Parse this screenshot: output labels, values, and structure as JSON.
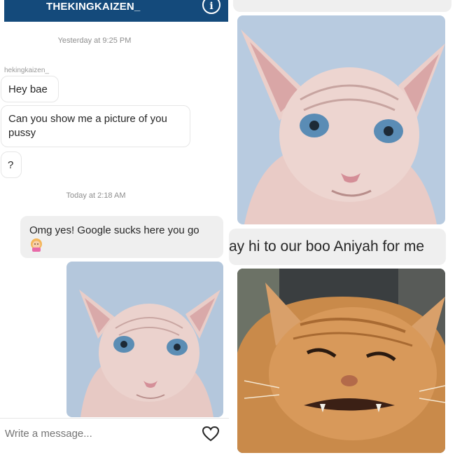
{
  "header": {
    "title": "THEKINGKAIZEN_"
  },
  "thread": {
    "timestamp_1": "Yesterday at 9:25 PM",
    "sender": "hekingkaizen_",
    "msg_1": "Hey bae",
    "msg_2": "Can you show me a picture of you pussy",
    "msg_3": "?",
    "timestamp_2": "Today at 2:18 AM",
    "msg_4": "Omg yes! Google sucks here you go"
  },
  "composer": {
    "placeholder": "Write a message..."
  },
  "right": {
    "caption": "ay hi to our boo Aniyah for me"
  },
  "icons": {
    "info": "info-icon",
    "heart": "heart-icon",
    "emoji": "emoji-icon"
  },
  "colors": {
    "header_bg": "#144a7b",
    "sent_bubble": "#efefef",
    "received_border": "#e6e6e6"
  }
}
